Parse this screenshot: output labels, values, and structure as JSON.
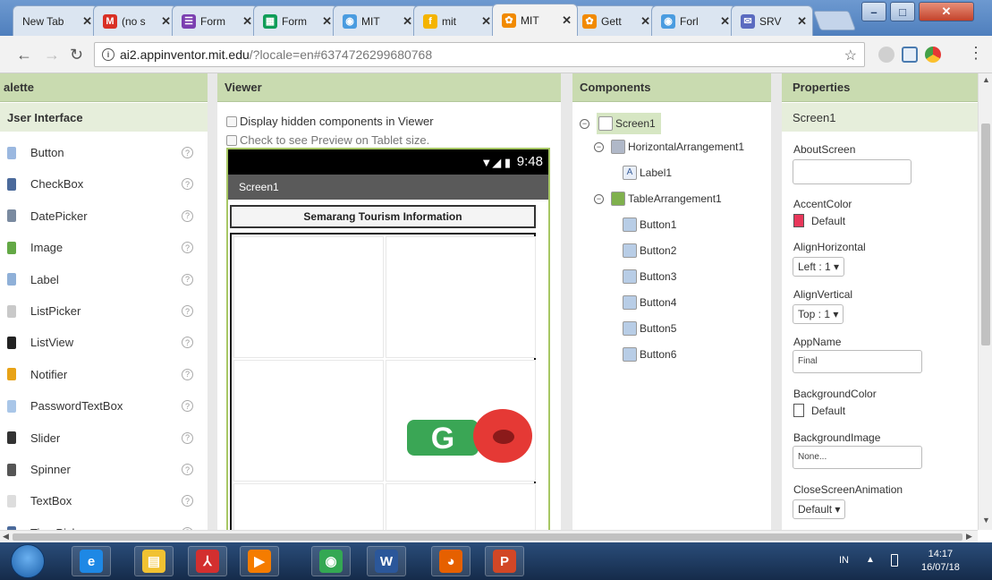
{
  "browser": {
    "tabs": [
      {
        "label": "New Tab",
        "color": "#9e9e9e",
        "icon": ""
      },
      {
        "label": "(no s",
        "color": "#d93025",
        "icon": "M"
      },
      {
        "label": "Form",
        "color": "#7b3fb0",
        "icon": "☰"
      },
      {
        "label": "Form",
        "color": "#0f9d58",
        "icon": "▦"
      },
      {
        "label": "MIT",
        "color": "#4a9ce0",
        "icon": "◉"
      },
      {
        "label": "mit",
        "color": "#f4b400",
        "icon": "f"
      },
      {
        "label": "MIT",
        "color": "#f18a00",
        "icon": "✿"
      },
      {
        "label": "Gett",
        "color": "#f18a00",
        "icon": "✿"
      },
      {
        "label": "Forl",
        "color": "#4a9ce0",
        "icon": "◉"
      },
      {
        "label": "SRV",
        "color": "#5b6bc0",
        "icon": "✉"
      }
    ],
    "close_glyph": "✕",
    "window_buttons": {
      "minimize": "–",
      "maximize": "□",
      "close": "✕"
    },
    "url_host": "ai2.appinventor.mit.edu",
    "url_rest": "/?locale=en#6374726299680768"
  },
  "palette": {
    "title": "alette",
    "section": "Jser Interface",
    "help_glyph": "?",
    "items": [
      {
        "label": "Button",
        "color": "#9bb8e0"
      },
      {
        "label": "CheckBox",
        "color": "#4b6a9b"
      },
      {
        "label": "DatePicker",
        "color": "#7a8aa0"
      },
      {
        "label": "Image",
        "color": "#63a845"
      },
      {
        "label": "Label",
        "color": "#8fb0d8"
      },
      {
        "label": "ListPicker",
        "color": "#c9c9c9"
      },
      {
        "label": "ListView",
        "color": "#222222"
      },
      {
        "label": "Notifier",
        "color": "#e8a317"
      },
      {
        "label": "PasswordTextBox",
        "color": "#a9c6e8"
      },
      {
        "label": "Slider",
        "color": "#333333"
      },
      {
        "label": "Spinner",
        "color": "#555555"
      },
      {
        "label": "TextBox",
        "color": "#dddddd"
      },
      {
        "label": "TimePicker",
        "color": "#4b6a9b"
      }
    ]
  },
  "viewer": {
    "title": "Viewer",
    "show_hidden": "Display hidden components in Viewer",
    "tablet_preview": "Check to see Preview on Tablet size.",
    "status_icons": "▼◢ ▮",
    "clock": "9:48",
    "screen_title": "Screen1",
    "app_title": "Semarang Tourism Information",
    "g_letter": "G"
  },
  "components": {
    "title": "Components",
    "toggle_glyph": "−",
    "tree": [
      {
        "label": "Screen1",
        "level": 0,
        "toggle": true,
        "selected": true,
        "color": "#ffffff"
      },
      {
        "label": "HorizontalArrangement1",
        "level": 1,
        "toggle": true,
        "selected": false,
        "color": "#b0b8c8"
      },
      {
        "label": "Label1",
        "level": 2,
        "toggle": false,
        "selected": false,
        "color": "#e8eef8",
        "icon_text": "A"
      },
      {
        "label": "TableArrangement1",
        "level": 1,
        "toggle": true,
        "selected": false,
        "color": "#7fb04d"
      },
      {
        "label": "Button1",
        "level": 2,
        "toggle": false,
        "selected": false,
        "color": "#b8cde6"
      },
      {
        "label": "Button2",
        "level": 2,
        "toggle": false,
        "selected": false,
        "color": "#b8cde6"
      },
      {
        "label": "Button3",
        "level": 2,
        "toggle": false,
        "selected": false,
        "color": "#b8cde6"
      },
      {
        "label": "Button4",
        "level": 2,
        "toggle": false,
        "selected": false,
        "color": "#b8cde6"
      },
      {
        "label": "Button5",
        "level": 2,
        "toggle": false,
        "selected": false,
        "color": "#b8cde6"
      },
      {
        "label": "Button6",
        "level": 2,
        "toggle": false,
        "selected": false,
        "color": "#b8cde6"
      }
    ]
  },
  "properties": {
    "title": "Properties",
    "component": "Screen1",
    "about_screen_label": "AboutScreen",
    "about_screen_value": "",
    "accent_color_label": "AccentColor",
    "accent_color_value": "Default",
    "accent_color_swatch": "#e8375a",
    "align_horizontal_label": "AlignHorizontal",
    "align_horizontal_value": "Left : 1 ▾",
    "align_vertical_label": "AlignVertical",
    "align_vertical_value": "Top : 1 ▾",
    "app_name_label": "AppName",
    "app_name_value": "Final",
    "background_color_label": "BackgroundColor",
    "background_color_value": "Default",
    "background_color_swatch": "#ffffff",
    "background_image_label": "BackgroundImage",
    "background_image_value": "None...",
    "close_anim_label": "CloseScreenAnimation",
    "close_anim_value": "Default ▾"
  },
  "taskbar": {
    "apps": [
      {
        "name": "internet-explorer",
        "glyph": "e",
        "color": "#1e88e5"
      },
      {
        "name": "file-explorer",
        "glyph": "▤",
        "color": "#f1c232"
      },
      {
        "name": "acrobat",
        "glyph": "⅄",
        "color": "#d32f2f"
      },
      {
        "name": "media-player",
        "glyph": "▶",
        "color": "#f57c00"
      },
      {
        "name": "chrome",
        "glyph": "◉",
        "color": "#34a853"
      },
      {
        "name": "word",
        "glyph": "W",
        "color": "#2b579a"
      },
      {
        "name": "firefox",
        "glyph": "◕",
        "color": "#e66000"
      },
      {
        "name": "powerpoint",
        "glyph": "P",
        "color": "#d24726"
      }
    ],
    "language": "IN",
    "up_arrow": "▲",
    "time": "14:17",
    "date": "16/07/18"
  }
}
